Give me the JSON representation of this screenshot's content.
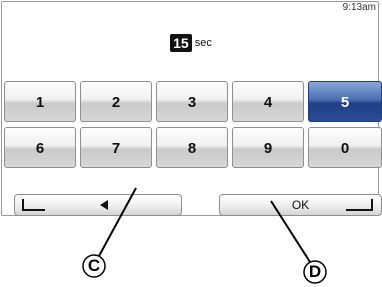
{
  "status": {
    "time": "9:13am"
  },
  "timer": {
    "value": "15",
    "unit": "sec"
  },
  "keypad": {
    "keys": [
      "1",
      "2",
      "3",
      "4",
      "5",
      "6",
      "7",
      "8",
      "9",
      "0"
    ],
    "selected": "5"
  },
  "bottom": {
    "ok_label": "OK"
  },
  "callouts": {
    "c": "C",
    "d": "D"
  },
  "colors": {
    "accent": "#1f3f86",
    "key_face": "#e6e6e6",
    "frame": "#9a9a9a"
  },
  "icons": {
    "back": "left-triangle-icon",
    "corner_left": "corner-bracket-left-icon",
    "corner_right": "corner-bracket-right-icon"
  }
}
